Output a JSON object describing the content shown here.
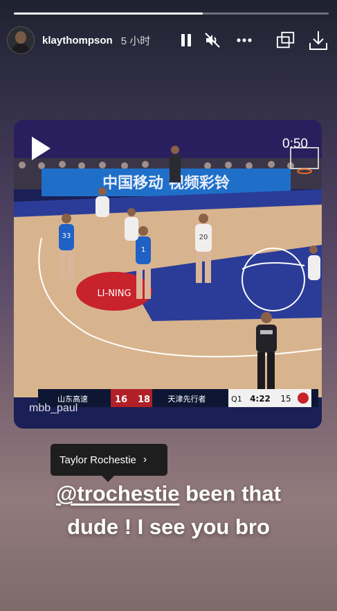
{
  "story": {
    "progress": 0.6,
    "user": {
      "username": "klaythompson",
      "time_ago": "5 小时",
      "avatar": "avatar"
    },
    "controls": {
      "pause_icon": "pause-icon",
      "mute_icon": "muted-speaker-icon",
      "more_icon": "more-icon",
      "share_icon": "external-window-icon",
      "download_icon": "download-icon"
    },
    "video": {
      "duration": "0:50",
      "watermark": "mbb_paul",
      "banner_text": "中国移动 视频彩铃",
      "scoreboard": {
        "home_team": "山东高速",
        "home_score": "16",
        "away_score": "18",
        "away_team": "天津先行者",
        "quarter": "Q1",
        "clock": "4:22",
        "shot_clock": "15"
      },
      "jersey_numbers": [
        "33",
        "1",
        "20"
      ]
    },
    "mention_tooltip": {
      "label": "Taylor Rochestie",
      "chevron": "›"
    },
    "caption": {
      "mention": "@trochestie",
      "line1_rest": " been that",
      "line2": "dude ! I see you bro"
    },
    "colors": {
      "accent_white": "#ffffff",
      "court_blue": "#2b3c98",
      "court_wood": "#d8b48e"
    }
  }
}
